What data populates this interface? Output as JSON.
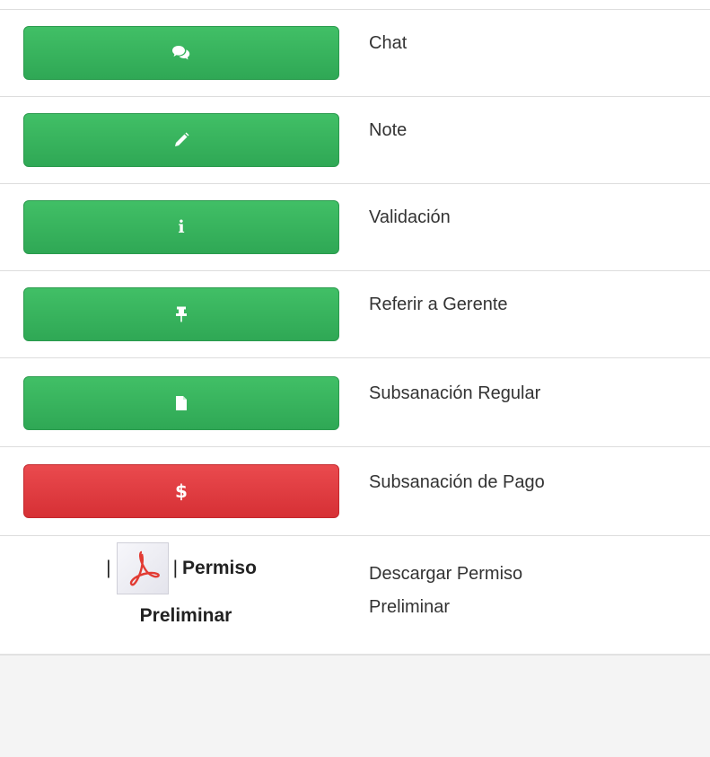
{
  "rows": [
    {
      "label": "Chat",
      "icon": "comments-icon",
      "color": "#33b05a"
    },
    {
      "label": "Note",
      "icon": "pencil-icon",
      "color": "#33b05a"
    },
    {
      "label": "Validación",
      "icon": "info-icon",
      "color": "#33b05a"
    },
    {
      "label": "Referir a Gerente",
      "icon": "pushpin-icon",
      "color": "#33b05a"
    },
    {
      "label": "Subsanación Regular",
      "icon": "file-icon",
      "color": "#33b05a"
    },
    {
      "label": "Subsanación de Pago",
      "icon": "dollar-icon",
      "color": "#dc3a3f"
    }
  ],
  "info_glyph": "i",
  "dollar_glyph": "$",
  "pdf_link": {
    "sep1": "|",
    "sep2": "|",
    "bold_text_1": "Permiso",
    "bold_text_2": "Preliminar",
    "icon": "pdf-icon"
  },
  "download": {
    "label_line1": "Descargar Permiso",
    "label_line2": "Preliminar"
  }
}
